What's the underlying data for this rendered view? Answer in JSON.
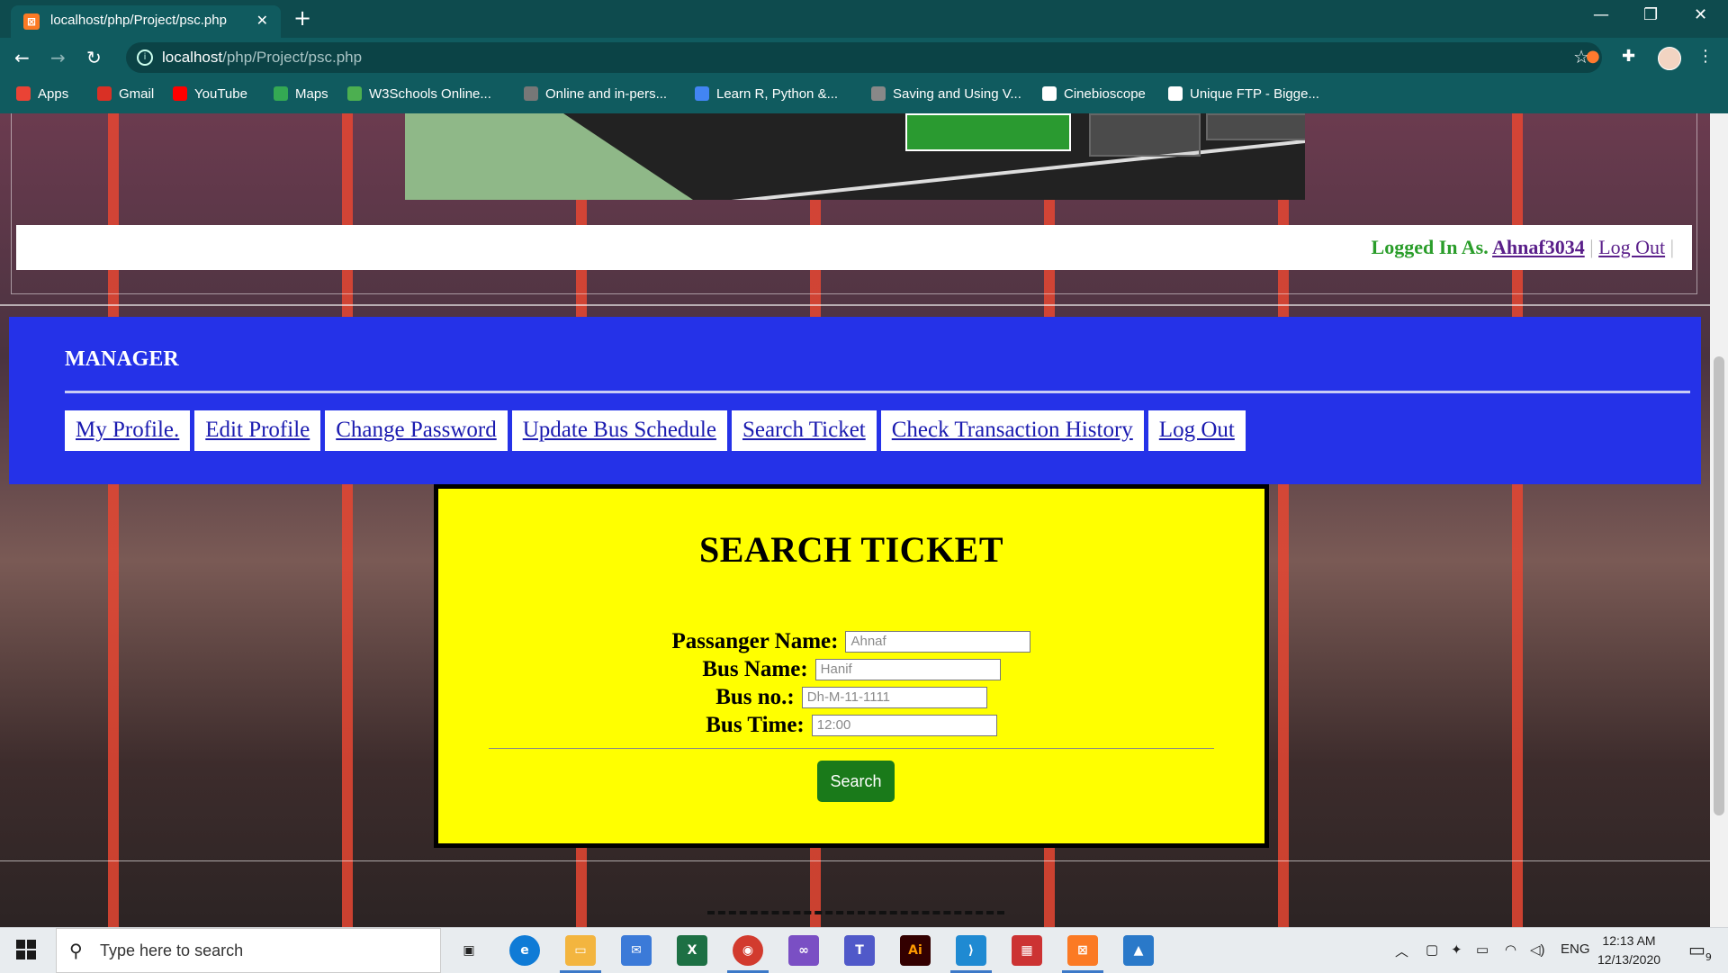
{
  "browser": {
    "tab_title": "localhost/php/Project/psc.php",
    "tab_close": "✕",
    "new_tab": "+",
    "url_host": "localhost",
    "url_path": "/php/Project/psc.php",
    "bookmarks": [
      {
        "label": "Apps",
        "color": "#ea4335"
      },
      {
        "label": "Gmail",
        "color": "#d93025"
      },
      {
        "label": "YouTube",
        "color": "#ff0000"
      },
      {
        "label": "Maps",
        "color": "#34a853"
      },
      {
        "label": "W3Schools Online...",
        "color": "#4caf50"
      },
      {
        "label": "Online and in-pers...",
        "color": "#777777"
      },
      {
        "label": "Learn R, Python &...",
        "color": "#4285f4"
      },
      {
        "label": "Saving and Using V...",
        "color": "#888888"
      },
      {
        "label": "Cinebioscope",
        "color": "#ffffff"
      },
      {
        "label": "Unique FTP - Bigge...",
        "color": "#ffffff"
      }
    ]
  },
  "page": {
    "login": {
      "prefix": "Logged In As.",
      "username": "Ahnaf3034",
      "logout": "Log Out",
      "sep": "|"
    },
    "role": "MANAGER",
    "menu": [
      "My Profile.",
      "Edit Profile",
      "Change Password",
      "Update Bus Schedule",
      "Search Ticket",
      "Check Transaction History",
      "Log Out"
    ],
    "panel": {
      "title": "SEARCH TICKET",
      "fields": [
        {
          "label": "Passanger Name:",
          "placeholder": "Ahnaf"
        },
        {
          "label": "Bus Name:",
          "placeholder": "Hanif"
        },
        {
          "label": "Bus no.:",
          "placeholder": "Dh-M-11-1111"
        },
        {
          "label": "Bus Time:",
          "placeholder": "12:00"
        }
      ],
      "button": "Search"
    }
  },
  "taskbar": {
    "search_placeholder": "Type here to search",
    "lang": "ENG",
    "time": "12:13 AM",
    "date": "12/13/2020",
    "notification_count": "9"
  }
}
